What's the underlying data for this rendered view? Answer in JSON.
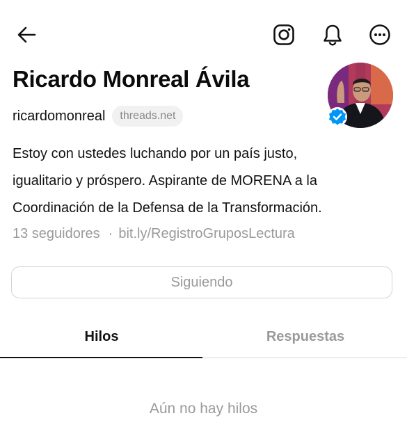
{
  "header": {
    "icons": [
      "arrow-left-icon",
      "instagram-icon",
      "bell-icon",
      "more-icon"
    ]
  },
  "profile": {
    "name": "Ricardo Monreal Ávila",
    "handle": "ricardomonreal",
    "domain": "threads.net",
    "verified": true,
    "bio_lines": [
      "Estoy con ustedes luchando por un país justo,",
      "igualitario y próspero. Aspirante de MORENA a la",
      "Coordinación de la Defensa de la Transformación."
    ],
    "followers": "13 seguidores",
    "separator": "·",
    "link": "bit.ly/RegistroGruposLectura"
  },
  "actions": {
    "follow_label": "Siguiendo"
  },
  "tabs": [
    {
      "label": "Hilos",
      "active": true
    },
    {
      "label": "Respuestas",
      "active": false
    }
  ],
  "feed": {
    "empty_message": "Aún no hay hilos"
  },
  "colors": {
    "text": "#101010",
    "muted": "#9a9a9a",
    "verified": "#0095f6",
    "border": "#d4d4d4"
  }
}
